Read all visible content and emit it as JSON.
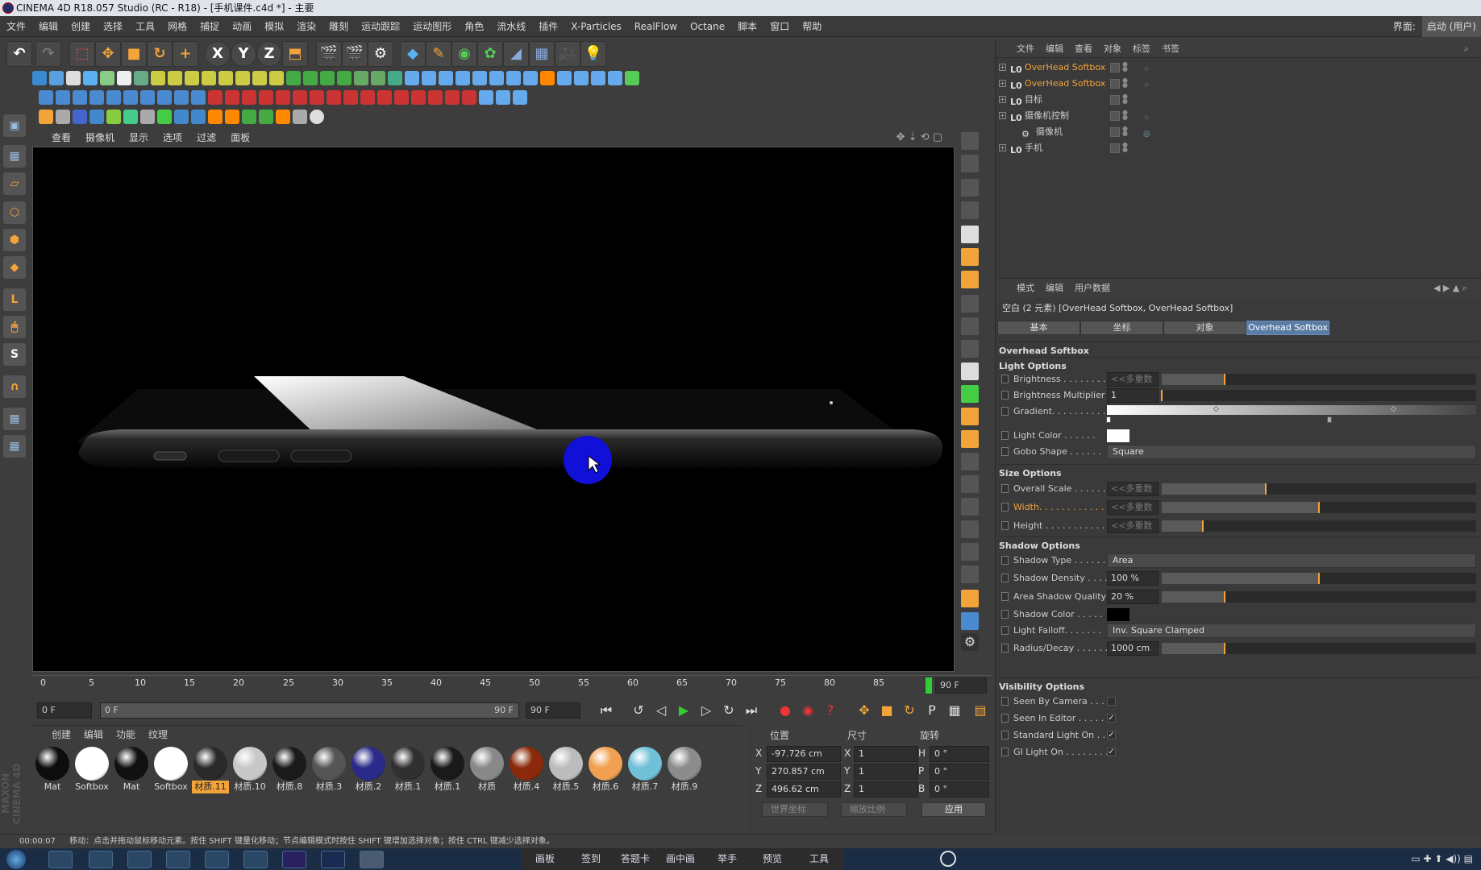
{
  "window": {
    "title": "CINEMA 4D R18.057 Studio (RC - R18) - [手机课件.c4d *] - 主要"
  },
  "menu": {
    "items": [
      "文件",
      "编辑",
      "创建",
      "选择",
      "工具",
      "网格",
      "捕捉",
      "动画",
      "模拟",
      "渲染",
      "雕刻",
      "运动跟踪",
      "运动图形",
      "角色",
      "流水线",
      "插件",
      "X-Particles",
      "RealFlow",
      "Octane",
      "脚本",
      "窗口",
      "帮助"
    ],
    "layout_label": "界面:",
    "layout_value": "启动 (用户)"
  },
  "viewport": {
    "menu": [
      "查看",
      "摄像机",
      "显示",
      "选项",
      "过滤",
      "面板"
    ]
  },
  "timeline": {
    "ticks": [
      "0",
      "5",
      "10",
      "15",
      "20",
      "25",
      "30",
      "35",
      "40",
      "45",
      "50",
      "55",
      "60",
      "65",
      "70",
      "75",
      "80",
      "85"
    ],
    "end_label": "90 F",
    "current_frame": "0 F",
    "range_start": "0 F",
    "range_end": "90 F",
    "max_frame": "90 F"
  },
  "materials": {
    "menu": [
      "创建",
      "编辑",
      "功能",
      "纹理"
    ],
    "items": [
      {
        "label": "Mat",
        "color": "#0d0d0d"
      },
      {
        "label": "Softbox",
        "color": "#ffffff"
      },
      {
        "label": "Mat",
        "color": "#111111"
      },
      {
        "label": "Softbox",
        "color": "#ffffff"
      },
      {
        "label": "材质.11",
        "color": "#2a2a2a",
        "selected": true
      },
      {
        "label": "材质.10",
        "color": "#c8c8c8"
      },
      {
        "label": "材质.8",
        "color": "#1a1a1a"
      },
      {
        "label": "材质.3",
        "color": "#555555"
      },
      {
        "label": "材质.2",
        "color": "#2a2a8a"
      },
      {
        "label": "材质.1",
        "color": "#303030"
      },
      {
        "label": "材质.1",
        "color": "#1a1a1a"
      },
      {
        "label": "材质",
        "color": "#888888"
      },
      {
        "label": "材质.4",
        "color": "#8a2a0a"
      },
      {
        "label": "材质.5",
        "color": "#bcbcbc"
      },
      {
        "label": "材质.6",
        "color": "#f0a050"
      },
      {
        "label": "材质.7",
        "color": "#70c0d8"
      },
      {
        "label": "材质.9",
        "color": "#8c8c8c"
      }
    ]
  },
  "coords": {
    "headers": [
      "位置",
      "尺寸",
      "旋转"
    ],
    "rows": [
      {
        "axis": "X",
        "pos": "-97.726 cm",
        "size_axis": "X",
        "size": "1",
        "rot_axis": "H",
        "rot": "0 °"
      },
      {
        "axis": "Y",
        "pos": "270.857 cm",
        "size_axis": "Y",
        "size": "1",
        "rot_axis": "P",
        "rot": "0 °"
      },
      {
        "axis": "Z",
        "pos": "496.62 cm",
        "size_axis": "Z",
        "size": "1",
        "rot_axis": "B",
        "rot": "0 °"
      }
    ],
    "mode1": "世界坐标",
    "mode2": "缩放比例",
    "apply": "应用"
  },
  "object_manager": {
    "menu": [
      "文件",
      "编辑",
      "查看",
      "对象",
      "标签",
      "书签"
    ],
    "objects": [
      {
        "name": "OverHead Softbox",
        "highlight": true,
        "indent": 0
      },
      {
        "name": "OverHead Softbox",
        "highlight": true,
        "indent": 0
      },
      {
        "name": "目标",
        "highlight": false,
        "indent": 0
      },
      {
        "name": "摄像机控制",
        "highlight": false,
        "indent": 0
      },
      {
        "name": "摄像机",
        "highlight": false,
        "indent": 1
      },
      {
        "name": "手机",
        "highlight": false,
        "indent": 0
      }
    ]
  },
  "attributes": {
    "menu": [
      "模式",
      "编辑",
      "用户数据"
    ],
    "title": "空白 (2 元素) [OverHead Softbox, OverHead Softbox]",
    "tabs": [
      "基本",
      "坐标",
      "对象",
      "Overhead Softbox"
    ],
    "active_tab": 3,
    "heading": "Overhead Softbox",
    "sections": {
      "light": "Light Options",
      "size": "Size Options",
      "shadow": "Shadow Options",
      "visibility": "Visibility Options"
    },
    "light": {
      "brightness": {
        "label": "Brightness . . . . . . . .",
        "value": "<<多重数",
        "fill": 0.2
      },
      "brightness_mult": {
        "label": "Brightness Multiplier",
        "value": "1",
        "fill": 0.0
      },
      "gradient": {
        "label": "Gradient. . . . . . . . . ."
      },
      "light_color": {
        "label": "Light Color . . . . . .",
        "color": "#ffffff"
      },
      "gobo_shape": {
        "label": "Gobo Shape . . . . . .",
        "value": "Square"
      }
    },
    "size": {
      "overall_scale": {
        "label": "Overall Scale . . . . . .",
        "value": "<<多重数",
        "fill": 0.33
      },
      "width": {
        "label": "Width. . . . . . . . . . . .",
        "value": "<<多重数",
        "fill": 0.5
      },
      "height": {
        "label": "Height . . . . . . . . . . .",
        "value": "<<多重数",
        "fill": 0.13
      }
    },
    "shadow": {
      "type": {
        "label": "Shadow Type . . . . . .",
        "value": "Area"
      },
      "density": {
        "label": "Shadow Density . . . .",
        "value": "100 %",
        "fill": 0.5
      },
      "quality": {
        "label": "Area Shadow Quality",
        "value": "20 %",
        "fill": 0.2
      },
      "color": {
        "label": "Shadow Color . . . . .",
        "color": "#000000"
      },
      "falloff": {
        "label": "Light Falloff. . . . . . .",
        "value": "Inv. Square Clamped"
      },
      "radius": {
        "label": "Radius/Decay . . . . . .",
        "value": "1000 cm",
        "fill": 0.2
      }
    },
    "visibility": {
      "seen_by_camera": {
        "label": "Seen By Camera . . . .",
        "checked": false
      },
      "seen_in_editor": {
        "label": "Seen In Editor . . . . .",
        "checked": true
      },
      "standard_light": {
        "label": "Standard Light On . .",
        "checked": true
      },
      "gi_light": {
        "label": "GI Light On . . . . . . . .",
        "checked": true
      }
    }
  },
  "status": {
    "time": "00:00:07",
    "message": "移动：点击并拖动鼠标移动元素。按住 SHIFT 键量化移动；节点编辑模式时按住 SHIFT 键增加选择对象；按住 CTRL 键减少选择对象。"
  },
  "taskbar": {
    "items": [
      "画板",
      "签到",
      "答题卡",
      "画中画",
      "举手",
      "预览",
      "工具"
    ]
  },
  "colors": {
    "accent": "#f2a43a",
    "active_tab": "#5a7ba3",
    "bg": "#3d3d3d"
  }
}
